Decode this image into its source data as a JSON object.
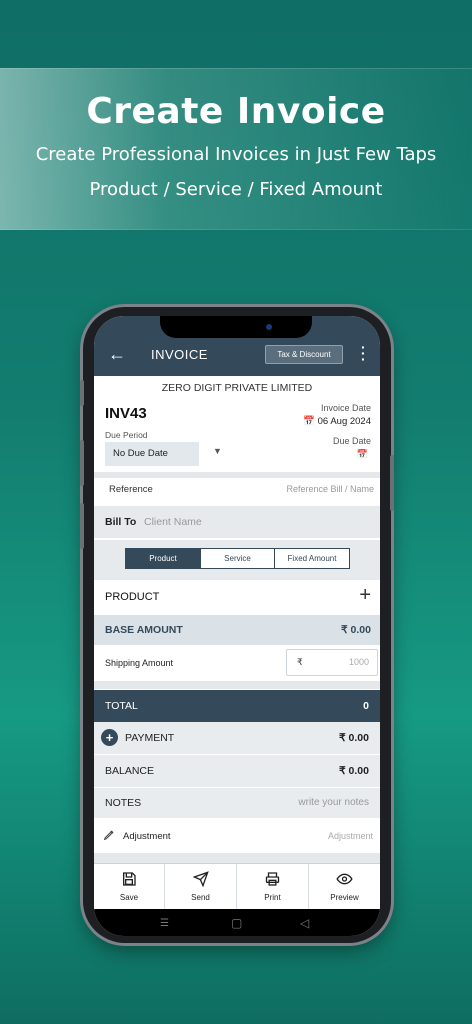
{
  "banner": {
    "title": "Create Invoice",
    "subtitle1": "Create Professional Invoices in Just Few Taps",
    "subtitle2": "Product / Service / Fixed Amount"
  },
  "appbar": {
    "back_icon": "arrow-left-icon",
    "title": "INVOICE",
    "tax_button": "Tax & Discount",
    "menu_icon": "more-vertical-icon"
  },
  "invoice": {
    "company": "ZERO DIGIT PRIVATE LIMITED",
    "number": "INV43",
    "date_label": "Invoice Date",
    "date_value": "06 Aug 2024",
    "due_period_label": "Due Period",
    "due_period_value": "No Due Date",
    "due_date_label": "Due Date"
  },
  "reference": {
    "label": "Reference",
    "placeholder": "Reference Bill / Name"
  },
  "bill_to": {
    "label": "Bill To",
    "placeholder": "Client Name"
  },
  "tabs": [
    {
      "label": "Product",
      "active": true
    },
    {
      "label": "Service",
      "active": false
    },
    {
      "label": "Fixed Amount",
      "active": false
    }
  ],
  "product": {
    "label": "PRODUCT"
  },
  "base_amount": {
    "label": "BASE AMOUNT",
    "value": "₹ 0.00"
  },
  "shipping": {
    "label": "Shipping Amount",
    "currency": "₹",
    "placeholder": "1000"
  },
  "total": {
    "label": "TOTAL",
    "value": "0"
  },
  "payment": {
    "label": "PAYMENT",
    "value": "₹ 0.00"
  },
  "balance": {
    "label": "BALANCE",
    "value": "₹ 0.00"
  },
  "notes": {
    "label": "NOTES",
    "placeholder": "write your notes"
  },
  "adjustment": {
    "label": "Adjustment",
    "placeholder": "Adjustment"
  },
  "bottom_bar": [
    {
      "label": "Save",
      "icon": "save-icon"
    },
    {
      "label": "Send",
      "icon": "send-icon"
    },
    {
      "label": "Print",
      "icon": "print-icon"
    },
    {
      "label": "Preview",
      "icon": "eye-icon"
    }
  ],
  "colors": {
    "primary": "#34495a",
    "background_teal": "#137d70"
  }
}
